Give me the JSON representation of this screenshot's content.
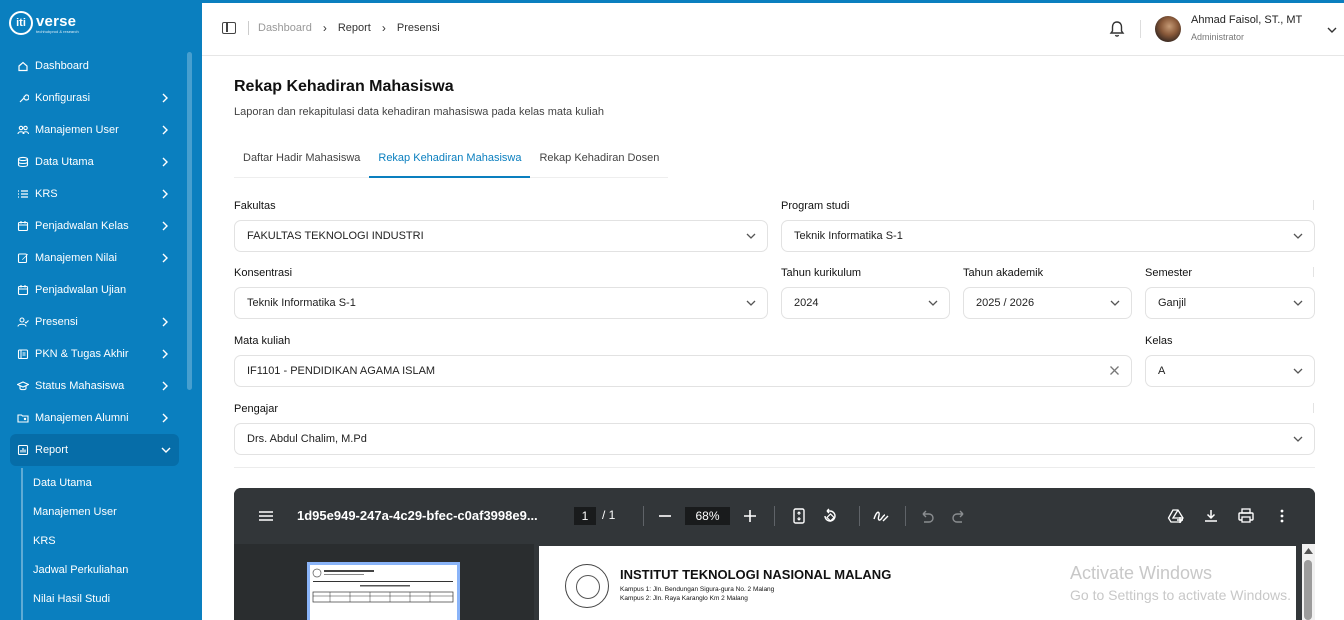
{
  "app": {
    "logo_text": "verse",
    "logo_mark": "iti",
    "logo_tagline": "techhubprod & research"
  },
  "sidebar": {
    "items": [
      {
        "label": "Dashboard",
        "icon": "home-icon",
        "has_chevron": false
      },
      {
        "label": "Konfigurasi",
        "icon": "wrench-icon",
        "has_chevron": true
      },
      {
        "label": "Manajemen User",
        "icon": "users-icon",
        "has_chevron": true
      },
      {
        "label": "Data Utama",
        "icon": "database-icon",
        "has_chevron": true
      },
      {
        "label": "KRS",
        "icon": "list-icon",
        "has_chevron": true
      },
      {
        "label": "Penjadwalan Kelas",
        "icon": "calendar-icon",
        "has_chevron": true
      },
      {
        "label": "Manajemen Nilai",
        "icon": "edit-icon",
        "has_chevron": true
      },
      {
        "label": "Penjadwalan Ujian",
        "icon": "calendar-icon",
        "has_chevron": false
      },
      {
        "label": "Presensi",
        "icon": "user-check-icon",
        "has_chevron": true
      },
      {
        "label": "PKN & Tugas Akhir",
        "icon": "book-icon",
        "has_chevron": true
      },
      {
        "label": "Status Mahasiswa",
        "icon": "graduation-cap-icon",
        "has_chevron": true
      },
      {
        "label": "Manajemen Alumni",
        "icon": "folder-user-icon",
        "has_chevron": true
      },
      {
        "label": "Report",
        "icon": "report-icon",
        "has_chevron": true,
        "active": true
      }
    ],
    "sub_items": [
      "Data Utama",
      "Manajemen User",
      "KRS",
      "Jadwal Perkuliahan",
      "Nilai Hasil Studi"
    ]
  },
  "breadcrumb": {
    "items": [
      "Dashboard",
      "Report",
      "Presensi"
    ]
  },
  "user": {
    "name": "Ahmad Faisol, ST., MT",
    "role": "Administrator"
  },
  "page": {
    "title": "Rekap Kehadiran Mahasiswa",
    "description": "Laporan dan rekapitulasi data kehadiran mahasiswa pada kelas mata kuliah"
  },
  "tabs": [
    {
      "label": "Daftar Hadir Mahasiswa",
      "active": false
    },
    {
      "label": "Rekap Kehadiran Mahasiswa",
      "active": true
    },
    {
      "label": "Rekap Kehadiran Dosen",
      "active": false
    }
  ],
  "form": {
    "fakultas": {
      "label": "Fakultas",
      "value": "FAKULTAS TEKNOLOGI INDUSTRI"
    },
    "program_studi": {
      "label": "Program studi",
      "value": "Teknik Informatika S-1"
    },
    "konsentrasi": {
      "label": "Konsentrasi",
      "value": "Teknik Informatika S-1"
    },
    "tahun_kurikulum": {
      "label": "Tahun kurikulum",
      "value": "2024"
    },
    "tahun_akademik": {
      "label": "Tahun akademik",
      "value": "2025 / 2026"
    },
    "semester": {
      "label": "Semester",
      "value": "Ganjil"
    },
    "mata_kuliah": {
      "label": "Mata kuliah",
      "value": "IF1101 - PENDIDIKAN AGAMA ISLAM"
    },
    "kelas": {
      "label": "Kelas",
      "value": "A"
    },
    "pengajar": {
      "label": "Pengajar",
      "value": "Drs. Abdul Chalim, M.Pd"
    }
  },
  "pdf_viewer": {
    "filename": "1d95e949-247a-4c29-bfec-c0af3998e9...",
    "page_current": "1",
    "page_total": "/ 1",
    "zoom": "68%",
    "document": {
      "institution": "INSTITUT TEKNOLOGI NASIONAL MALANG",
      "campus1": "Kampus 1: Jln. Bendungan Sigura-gura No. 2 Malang",
      "campus2": "Kampus 2: Jln. Raya Karanglo Km 2 Malang"
    }
  },
  "watermark": {
    "line1": "Activate Windows",
    "line2": "Go to Settings to activate Windows."
  },
  "colors": {
    "brand": "#0a7fbf",
    "active_tab": "#0a7fbf",
    "viewer_bg": "#323639"
  }
}
